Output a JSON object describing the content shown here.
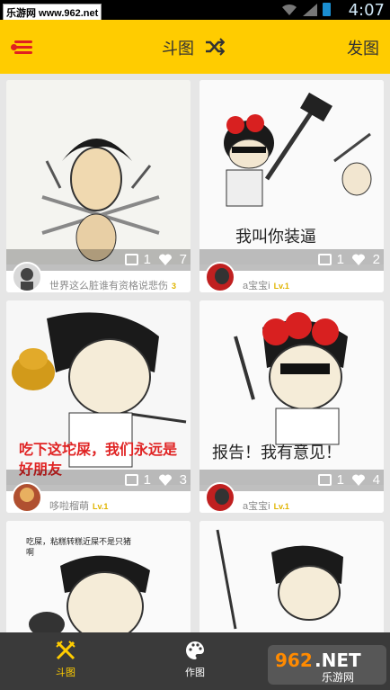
{
  "status_bar": {
    "watermark": "乐游网 www.962.net",
    "time": "4:07",
    "icons": [
      "wifi-icon",
      "signal-icon",
      "battery-icon"
    ]
  },
  "app_bar": {
    "title": "斗图",
    "post_label": "发图",
    "icons": [
      "menu-icon",
      "shuffle-icon"
    ],
    "accent_color": "#ffcc00"
  },
  "cards": [
    {
      "caption": "",
      "image_count": "1",
      "likes": "7",
      "author": "世界这么脏谁有资格说悲伤",
      "level": "3"
    },
    {
      "caption": "我叫你装逼",
      "image_count": "1",
      "likes": "2",
      "author": "a宝宝i",
      "level": "Lv.1"
    },
    {
      "caption": "吃下这坨屎，我们永远是好朋友",
      "image_count": "1",
      "likes": "3",
      "author": "哆啦榴萌",
      "level": "Lv.1"
    },
    {
      "caption": "报告！我有意见！",
      "image_count": "1",
      "likes": "4",
      "author": "a宝宝i",
      "level": "Lv.1"
    },
    {
      "caption": "吃屎，粘糕转糕近屎不是只猪啊",
      "image_count": "",
      "likes": "",
      "author": "",
      "level": ""
    },
    {
      "caption": "",
      "image_count": "",
      "likes": "",
      "author": "",
      "level": ""
    }
  ],
  "bottom_nav": {
    "items": [
      {
        "label": "斗图",
        "icon": "crossed-swords-icon",
        "active": true
      },
      {
        "label": "作图",
        "icon": "palette-icon",
        "active": false
      }
    ],
    "watermark": "962.NET 乐游网"
  }
}
